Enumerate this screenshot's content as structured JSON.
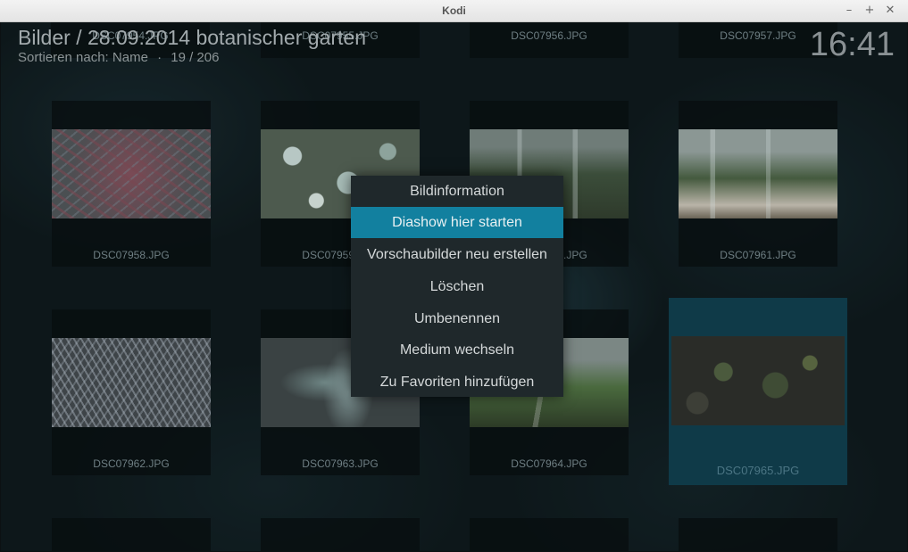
{
  "window": {
    "title": "Kodi",
    "minimize": "–",
    "maximize": "+",
    "close": "✕"
  },
  "header": {
    "title": "Bilder / 28.09.2014 botanischer garten",
    "sort_label": "Sortieren nach: Name",
    "separator": "·",
    "position": "19 / 206"
  },
  "clock": "16:41",
  "tiles": {
    "top": [
      "DSC07954.JPG",
      "DSC07955.JPG",
      "DSC07956.JPG",
      "DSC07957.JPG"
    ],
    "row1": [
      "DSC07958.JPG",
      "DSC07959.JPG",
      "DSC07960.JPG",
      "DSC07961.JPG"
    ],
    "row2": [
      "DSC07962.JPG",
      "DSC07963.JPG",
      "DSC07964.JPG",
      "DSC07965.JPG"
    ]
  },
  "focused_item": "DSC07965.JPG",
  "context_menu": {
    "items": [
      "Bildinformation",
      "Diashow hier starten",
      "Vorschaubilder neu erstellen",
      "Löschen",
      "Umbenennen",
      "Medium wechseln",
      "Zu Favoriten hinzufügen"
    ],
    "active_index": 1
  },
  "colors": {
    "accent": "#12809f",
    "menu_bg": "#1f282b",
    "focus_bg": "#0f3a48"
  }
}
